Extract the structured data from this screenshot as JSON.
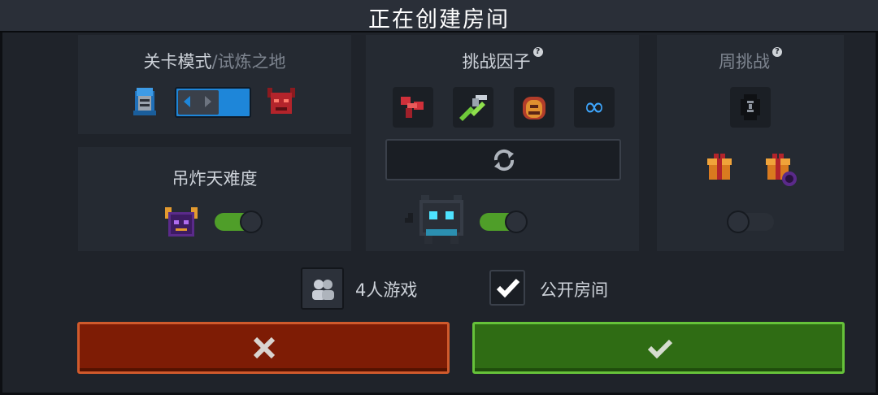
{
  "dialog": {
    "title": "正在创建房间"
  },
  "level_mode": {
    "label": "关卡模式",
    "separator": "/",
    "value": "试炼之地"
  },
  "difficulty": {
    "label": "吊炸天难度",
    "enabled": true
  },
  "challenge": {
    "label": "挑战因子",
    "enabled": true
  },
  "weekly": {
    "label": "周挑战",
    "enabled": false
  },
  "options": {
    "players_label": "4人游戏",
    "public_label": "公开房间",
    "public_checked": true
  },
  "colors": {
    "cancel": "#7e1c05",
    "confirm": "#2f6c14",
    "toggle_on": "#4f9e29",
    "slider_blue": "#1e86d9"
  },
  "icons": {
    "help": "?",
    "infinity": "∞",
    "refresh": "refresh-icon",
    "cancel": "x-icon",
    "confirm": "check-icon"
  }
}
